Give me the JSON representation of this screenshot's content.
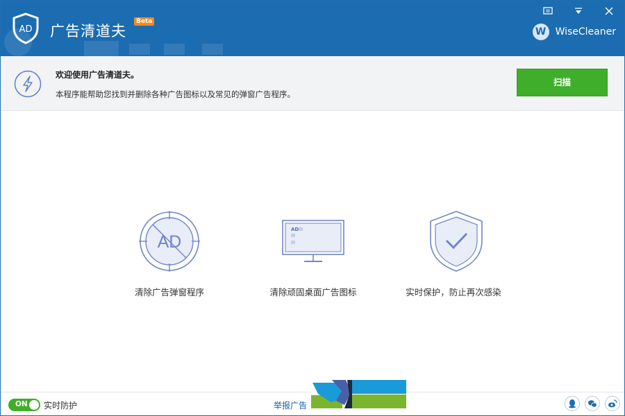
{
  "app": {
    "title": "广告清道夫",
    "badge": "Beta",
    "brand": "WiseCleaner",
    "brand_initial": "W"
  },
  "window_controls": [
    "feedback-icon",
    "menu-icon",
    "close-icon"
  ],
  "welcome": {
    "title": "欢迎使用广告清道夫。",
    "description": "本程序能帮助您找到并删除各种广告图标以及常见的弹窗广告程序。",
    "scan_button": "扫描",
    "icon": "lightning-bolt-icon"
  },
  "features": [
    {
      "icon": "ad-block-icon",
      "icon_text": "AD",
      "label": "清除广告弹窗程序"
    },
    {
      "icon": "desktop-ad-icon",
      "icon_text": "AD",
      "label": "清除顽固桌面广告图标"
    },
    {
      "icon": "shield-check-icon",
      "label": "实时保护，防止再次感染"
    }
  ],
  "footer": {
    "toggle_state": "ON",
    "realtime_label": "实时防护",
    "report_link": "举报广告",
    "social": [
      "qq-icon",
      "wechat-icon",
      "weibo-icon"
    ]
  },
  "colors": {
    "header": "#1b6cb0",
    "scan_button": "#3fae2a",
    "toggle": "#3fae2a",
    "badge": "#f08a24",
    "icon_stroke": "#6f86c6",
    "icon_fill": "#e8edf8"
  }
}
